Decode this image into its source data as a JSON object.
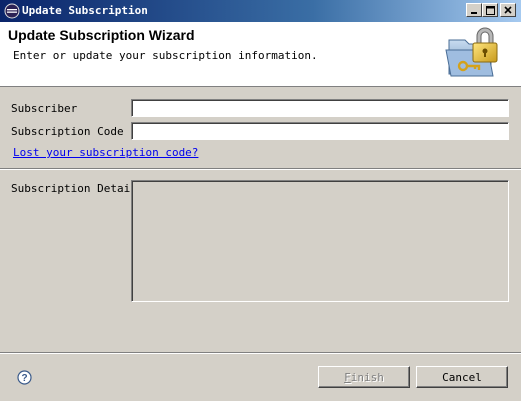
{
  "window": {
    "title": "Update Subscription",
    "controls": [
      "minimize-icon",
      "maximize-icon",
      "close-icon"
    ]
  },
  "header": {
    "title": "Update Subscription Wizard",
    "description": "Enter or update your subscription information.",
    "image_icon": "folder-lock-key-icon"
  },
  "form": {
    "subscriber_label": "Subscriber",
    "subscriber_value": "",
    "code_label": "Subscription Code",
    "code_value": "",
    "lost_code_link": "Lost your subscription code?",
    "detail_label": "Subscription Detail",
    "detail_value": ""
  },
  "footer": {
    "help_icon": "help-icon",
    "finish_label": "Finish",
    "finish_mnemonic": "F",
    "finish_enabled": false,
    "cancel_label": "Cancel"
  },
  "colors": {
    "dialog_bg": "#d4d0c8",
    "titlebar_start": "#0a246a",
    "titlebar_end": "#a6caf0",
    "link": "#0000ee",
    "disabled_text": "#808080"
  }
}
